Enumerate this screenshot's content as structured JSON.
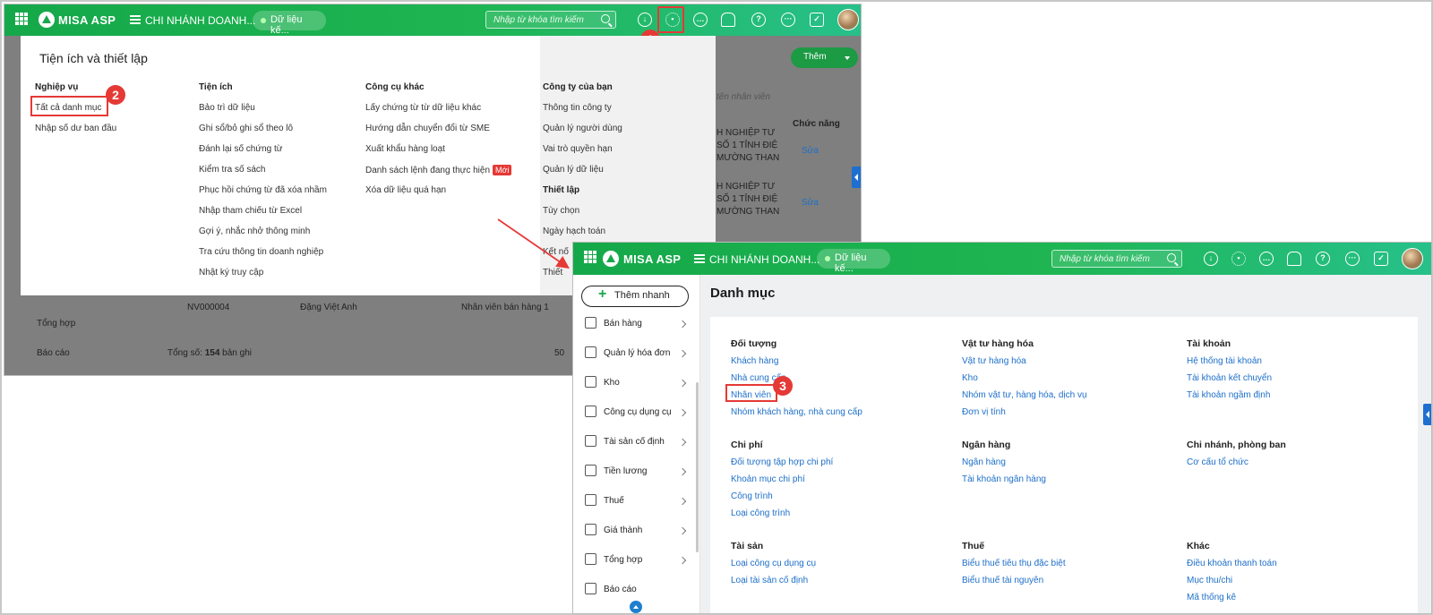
{
  "app": {
    "brand": "MISA ASP",
    "branch": "CHI NHÁNH DOANH...",
    "branch2": "CHI NHÁNH DOANH...",
    "data_status": "Dữ liệu kế...",
    "search_placeholder": "Nhập từ khóa tìm kiếm"
  },
  "steps": {
    "one": "1",
    "two": "2",
    "three": "3"
  },
  "settings_panel": {
    "title": "Tiện ích và thiết lập",
    "columns": [
      {
        "heading": "Nghiệp vụ",
        "items": [
          "Tất cả danh mục",
          "Nhập số dư ban đầu"
        ]
      },
      {
        "heading": "Tiện ích",
        "items": [
          "Bảo trì dữ liệu",
          "Ghi sổ/bỏ ghi sổ theo lô",
          "Đánh lại số chứng từ",
          "Kiểm tra số sách",
          "Phục hồi chứng từ đã xóa nhầm",
          "Nhập tham chiếu từ Excel",
          "Gợi ý, nhắc nhở thông minh",
          "Tra cứu thông tin doanh nghiệp",
          "Nhật ký truy cập"
        ]
      },
      {
        "heading": "Công cụ khác",
        "items": [
          "Lấy chứng từ từ dữ liệu khác",
          "Hướng dẫn chuyển đổi từ SME",
          "Xuất khẩu hàng loạt",
          "Danh sách lệnh đang thực hiện",
          "Xóa dữ liệu quá hạn"
        ],
        "new_badge": "Mới"
      },
      {
        "heading": "Công ty của bạn",
        "items": [
          "Thông tin công ty",
          "Quản lý người dùng",
          "Vai trò quyền hạn",
          "Quản lý dữ liệu"
        ],
        "heading2": "Thiết lập",
        "items2": [
          "Tùy chọn",
          "Ngày hạch toán",
          "Kết nố",
          "Thiết"
        ]
      }
    ]
  },
  "background_view": {
    "add_button": "Thêm",
    "search_placeholder": "tên nhân viên",
    "col_function": "Chức năng",
    "edit1": "Sửa",
    "edit2": "Sửa",
    "snippet1a": "H NGHIỆP TƯ",
    "snippet1b": "SỐ 1 TỈNH ĐIỆ",
    "snippet1c": "MƯỜNG THAN",
    "snippet2a": "H NGHIỆP TƯ",
    "snippet2b": "SỐ 1 TỈNH ĐIỆ",
    "snippet2c": "MƯỜNG THAN",
    "row_code": "NV000004",
    "row_name": "Đặng Việt Anh",
    "row_role": "Nhân viên bán hàng 1",
    "total_prefix": "Tổng số:",
    "total_count": "154",
    "total_suffix": "bản ghi",
    "page_size": "50",
    "sidebar_summary": "Tổng hợp",
    "sidebar_report": "Báo cáo"
  },
  "sidebar": {
    "quick_add": "Thêm nhanh",
    "items": [
      {
        "label": "Bán hàng",
        "icon": "cart-icon"
      },
      {
        "label": "Quản lý hóa đơn",
        "icon": "invoice-icon"
      },
      {
        "label": "Kho",
        "icon": "warehouse-icon"
      },
      {
        "label": "Công cụ dụng cụ",
        "icon": "tools-icon"
      },
      {
        "label": "Tài sản cố định",
        "icon": "car-icon"
      },
      {
        "label": "Tiền lương",
        "icon": "payroll-icon"
      },
      {
        "label": "Thuế",
        "icon": "tax-icon"
      },
      {
        "label": "Giá thành",
        "icon": "price-tag-icon"
      },
      {
        "label": "Tổng hợp",
        "icon": "summary-icon"
      },
      {
        "label": "Báo cáo",
        "icon": "report-icon"
      }
    ]
  },
  "catalog": {
    "title": "Danh mục",
    "groups": [
      {
        "heading": "Đối tượng",
        "links": [
          "Khách hàng",
          "Nhà cung cấp",
          "Nhân viên",
          "Nhóm khách hàng, nhà cung cấp"
        ]
      },
      {
        "heading": "Vật tư hàng hóa",
        "links": [
          "Vật tư hàng hóa",
          "Kho",
          "Nhóm vật tư, hàng hóa, dịch vụ",
          "Đơn vị tính"
        ]
      },
      {
        "heading": "Tài khoản",
        "links": [
          "Hệ thống tài khoản",
          "Tài khoản kết chuyển",
          "Tài khoản ngầm định"
        ]
      },
      {
        "heading": "Chi phí",
        "links": [
          "Đối tượng tập hợp chi phí",
          "Khoản mục chi phí",
          "Công trình",
          "Loại công trình"
        ]
      },
      {
        "heading": "Ngân hàng",
        "links": [
          "Ngân hàng",
          "Tài khoản ngân hàng"
        ]
      },
      {
        "heading": "Chi nhánh, phòng ban",
        "links": [
          "Cơ cấu tổ chức"
        ]
      },
      {
        "heading": "Tài sản",
        "links": [
          "Loại công cụ dụng cụ",
          "Loại tài sản cố định"
        ]
      },
      {
        "heading": "Thuế",
        "links": [
          "Biểu thuế tiêu thụ đặc biệt",
          "Biểu thuế tài nguyên"
        ]
      },
      {
        "heading": "Khác",
        "links": [
          "Điều khoản thanh toán",
          "Mục thu/chi",
          "Mã thống kê"
        ]
      }
    ]
  },
  "colors": {
    "brand_green": "#1aa64b",
    "highlight_red": "#e53935",
    "link_blue": "#1d6fc9"
  }
}
